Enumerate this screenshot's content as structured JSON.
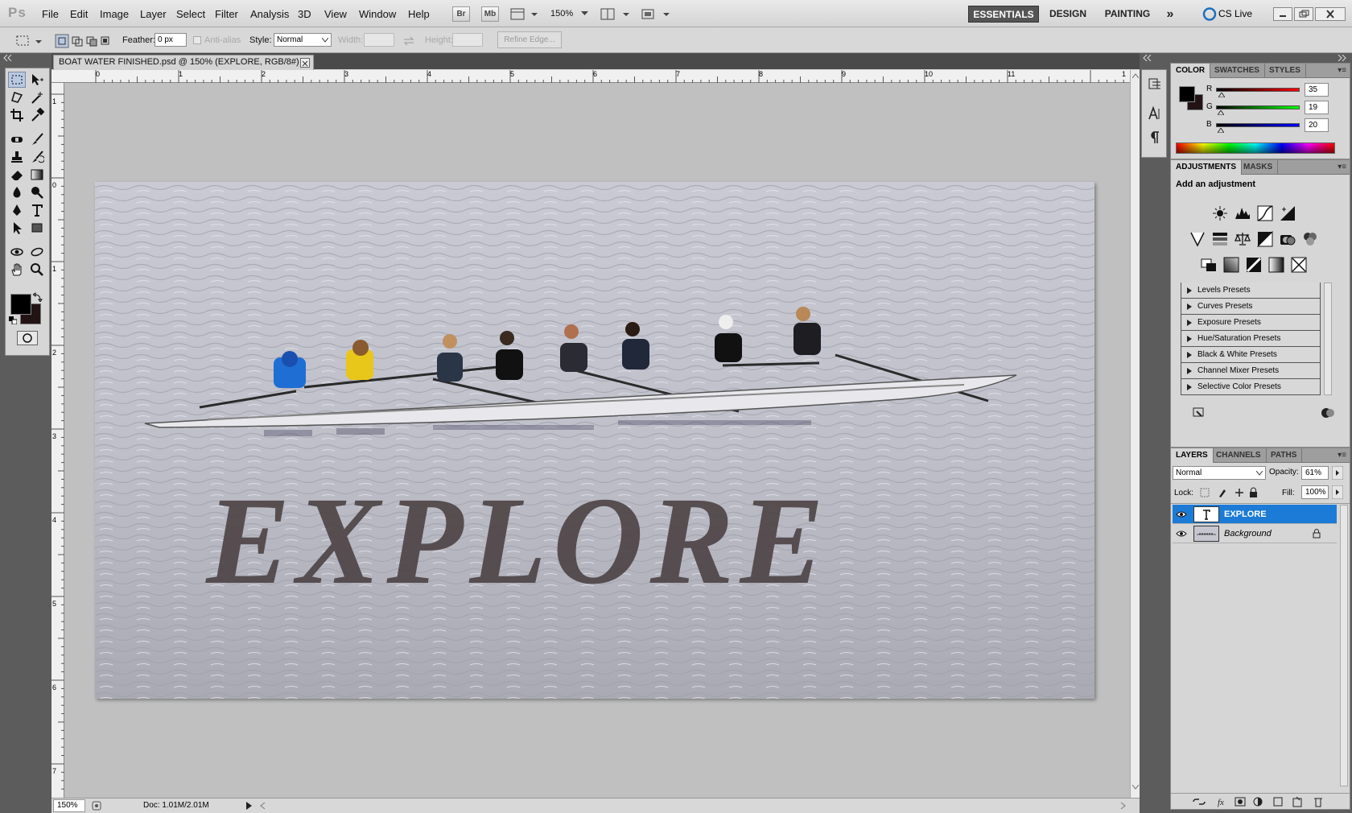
{
  "app": {
    "logo": "Ps",
    "workspace": "ESSENTIALS"
  },
  "menu": [
    "File",
    "Edit",
    "Image",
    "Layer",
    "Select",
    "Filter",
    "Analysis",
    "3D",
    "View",
    "Window",
    "Help"
  ],
  "menubar": {
    "bridge_label": "Br",
    "minibridge_label": "Mb",
    "zoom": "150%",
    "workspaces": [
      "ESSENTIALS",
      "DESIGN",
      "PAINTING"
    ],
    "more": "»",
    "cslive": "CS Live"
  },
  "options": {
    "feather_label": "Feather:",
    "feather_value": "0 px",
    "antialias_label": "Anti-alias",
    "style_label": "Style:",
    "style_value": "Normal",
    "width_label": "Width:",
    "height_label": "Height:",
    "refine_label": "Refine Edge..."
  },
  "document": {
    "tab_title": "BOAT WATER FINISHED.psd @ 150% (EXPLORE, RGB/8#)",
    "overlay_text": "EXPLORE",
    "ruler_top": [
      "0",
      "1",
      "2",
      "3",
      "4",
      "5",
      "6",
      "7",
      "8",
      "9",
      "10",
      "11",
      "1"
    ],
    "ruler_left": [
      "1",
      "0",
      "1",
      "2",
      "3",
      "4",
      "5",
      "6",
      "7"
    ]
  },
  "status": {
    "zoom": "150%",
    "doc": "Doc: 1.01M/2.01M"
  },
  "color_panel": {
    "tabs": [
      "COLOR",
      "SWATCHES",
      "STYLES"
    ],
    "channels": [
      {
        "label": "R",
        "value": "35"
      },
      {
        "label": "G",
        "value": "19"
      },
      {
        "label": "B",
        "value": "20"
      }
    ],
    "foreground": "#231314",
    "background": "#000000"
  },
  "adjustments_panel": {
    "tabs": [
      "ADJUSTMENTS",
      "MASKS"
    ],
    "heading": "Add an adjustment",
    "presets": [
      "Levels Presets",
      "Curves Presets",
      "Exposure Presets",
      "Hue/Saturation Presets",
      "Black & White Presets",
      "Channel Mixer Presets",
      "Selective Color Presets"
    ]
  },
  "layers_panel": {
    "tabs": [
      "LAYERS",
      "CHANNELS",
      "PATHS"
    ],
    "blend_mode": "Normal",
    "opacity_label": "Opacity:",
    "opacity": "61%",
    "lock_label": "Lock:",
    "fill_label": "Fill:",
    "fill": "100%",
    "layers": [
      {
        "name": "EXPLORE",
        "type": "text",
        "selected": true
      },
      {
        "name": "Background",
        "type": "image",
        "locked": true
      }
    ]
  },
  "colors": {
    "selection": "#1c7bd6",
    "panel_bg": "#d6d6d6",
    "dark_chrome": "#5c5c5c"
  }
}
